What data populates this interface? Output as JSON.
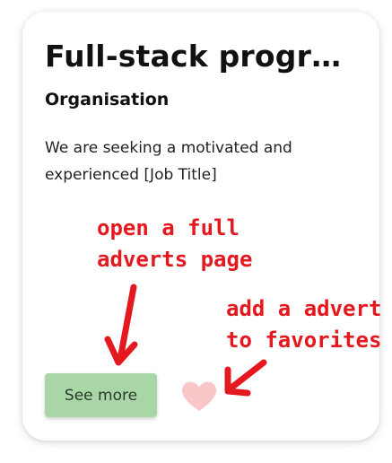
{
  "card": {
    "title": "Full-stack progra...",
    "organisation": "Organisation",
    "description": "We are seeking a motivated and experienced [Job Title]",
    "see_more_label": "See more",
    "favorite_icon": "heart-icon"
  },
  "annotations": {
    "open_page_line1": "open a full",
    "open_page_line2": "adverts page",
    "favorite_line1": "add a advert",
    "favorite_line2": "to favorites"
  },
  "colors": {
    "annotation": "#e3191f",
    "button_bg": "#a9d6a6",
    "heart": "#f9c7c8"
  }
}
